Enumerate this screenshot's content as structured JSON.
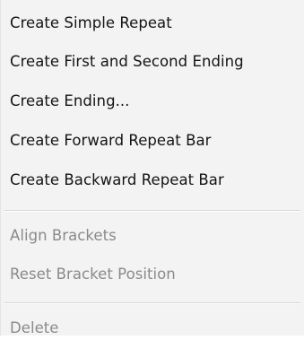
{
  "context_menu": {
    "items": [
      {
        "label": "Create Simple Repeat",
        "enabled": true
      },
      {
        "label": "Create First and Second Ending",
        "enabled": true
      },
      {
        "label": "Create Ending...",
        "enabled": true
      },
      {
        "label": "Create Forward Repeat Bar",
        "enabled": true
      },
      {
        "label": "Create Backward Repeat Bar",
        "enabled": true
      },
      {
        "label": "Align Brackets",
        "enabled": false
      },
      {
        "label": "Reset Bracket Position",
        "enabled": false
      },
      {
        "label": "Delete",
        "enabled": false
      }
    ]
  }
}
